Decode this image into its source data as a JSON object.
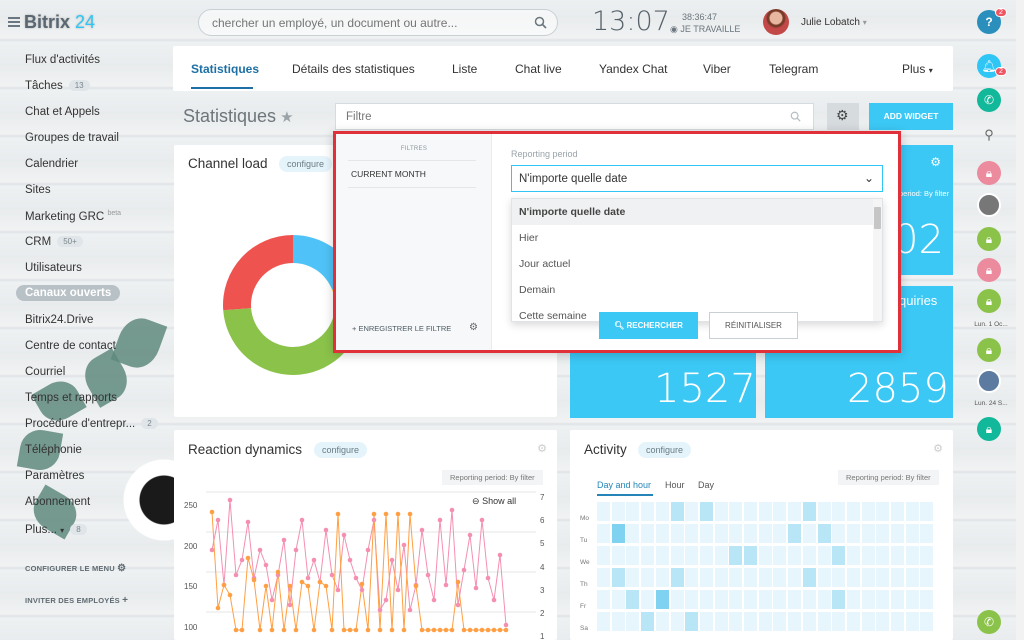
{
  "app": {
    "logo_brand": "Bitrix",
    "logo_num": "24"
  },
  "search": {
    "placeholder": "chercher un employé, un document ou autre..."
  },
  "clock": {
    "time": "13:07",
    "seconds": "38:36:47",
    "state": "JE TRAVAILLE"
  },
  "user": {
    "name": "Julie Lobatch"
  },
  "sidebar": {
    "items": [
      {
        "label": "Flux d'activités"
      },
      {
        "label": "Tâches",
        "count": "13"
      },
      {
        "label": "Chat et Appels"
      },
      {
        "label": "Groupes de travail"
      },
      {
        "label": "Calendrier"
      },
      {
        "label": "Sites"
      },
      {
        "label": "Marketing GRC",
        "sup": "beta"
      },
      {
        "label": "CRM",
        "count": "50+"
      },
      {
        "label": "Utilisateurs"
      },
      {
        "label": "Canaux ouverts"
      },
      {
        "label": "Bitrix24.Drive"
      },
      {
        "label": "Centre de contact"
      },
      {
        "label": "Courriel"
      },
      {
        "label": "Temps et rapports"
      },
      {
        "label": "Procédure d'entrepr...",
        "count": "2"
      },
      {
        "label": "Téléphonie"
      },
      {
        "label": "Paramètres"
      },
      {
        "label": "Abonnement"
      },
      {
        "label": "Plus...",
        "count": "8"
      }
    ],
    "configure": "CONFIGURER LE MENU",
    "invite": "INVITER DES EMPLOYÉS"
  },
  "tabs": [
    "Statistiques",
    "Détails des statistiques",
    "Liste",
    "Chat live",
    "Yandex Chat",
    "Viber",
    "Telegram",
    "Plus"
  ],
  "page": {
    "title": "Statistiques",
    "filter_placeholder": "Filtre",
    "add_widget": "ADD WIDGET"
  },
  "filter_popup": {
    "filtres_label": "FILTRES",
    "preset": "CURRENT MONTH",
    "save": "ENREGISTRER LE FILTRE",
    "period_label": "Reporting period",
    "period_value": "N'importe quelle date",
    "options": [
      "N'importe quelle date",
      "Hier",
      "Jour actuel",
      "Demain",
      "Cette semaine"
    ],
    "search_btn": "RECHERCHER",
    "reset_btn": "RÉINITIALISER"
  },
  "widgets": {
    "channel_load": {
      "title": "Channel load",
      "configure": "configure"
    },
    "card_top_right": {
      "reporting": "period: By filter",
      "value": "02"
    },
    "card_bottom_left": {
      "value": "1527"
    },
    "card_bottom_right": {
      "title": "quiries",
      "value": "2859"
    },
    "reaction": {
      "title": "Reaction dynamics",
      "configure": "configure",
      "reporting": "Reporting period: By filter",
      "show_all": "Show all"
    },
    "activity": {
      "title": "Activity",
      "configure": "configure",
      "reporting": "Reporting period: By filter",
      "tabs": [
        "Day and hour",
        "Hour",
        "Day"
      ],
      "days": [
        "Mo",
        "Tu",
        "We",
        "Th",
        "Fr",
        "Sa"
      ]
    }
  },
  "donut": {
    "segments": [
      {
        "color": "#4fc3f7",
        "value": 16
      },
      {
        "color": "#ffc107",
        "value": 8
      },
      {
        "color": "#8bc34a",
        "value": 38
      },
      {
        "color": "#ef5350",
        "value": 22
      }
    ]
  },
  "reaction_axes": {
    "left": [
      "250",
      "200",
      "150",
      "100"
    ],
    "right": [
      "7",
      "6",
      "5",
      "4",
      "3",
      "2",
      "1"
    ]
  },
  "rightbar": {
    "help_badge": "2",
    "bell_badge": "2",
    "date1": "Lun. 1 Oc...",
    "date2": "Lun. 24 S..."
  },
  "colors": {
    "accent": "#3bc8f5",
    "active_tab": "#1d6fa5",
    "highlight_border": "#e0313a"
  }
}
